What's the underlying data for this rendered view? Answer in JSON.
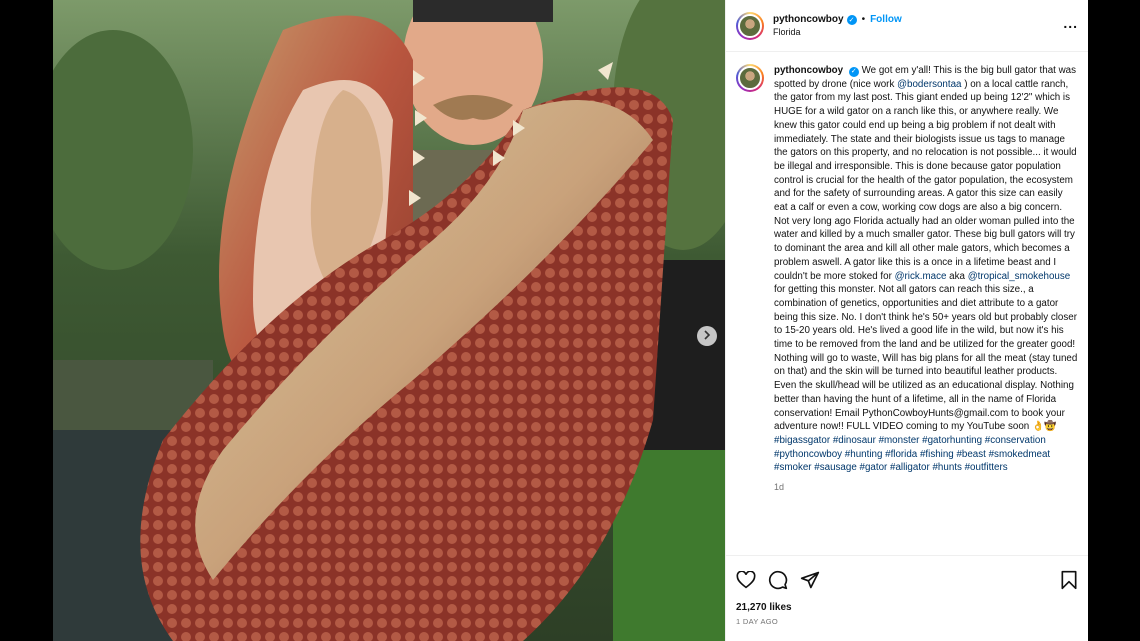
{
  "header": {
    "username": "pythoncowboy",
    "follow_label": "Follow",
    "location": "Florida",
    "more_label": "..."
  },
  "caption": {
    "username": "pythoncowboy",
    "segments": [
      {
        "t": "We got em y'all! This is the big bull gator that was spotted by drone (nice work "
      },
      {
        "t": "@bodersontaa",
        "link": true
      },
      {
        "t": " ) on a local cattle ranch, the gator from my last post. This giant ended up being 12'2\" which is HUGE for a wild gator on a ranch like this, or anywhere really. We knew this gator could end up being a big problem if not dealt with immediately. The state and their biologists issue us tags to manage the gators on this property, and no relocation is not possible... it would be illegal and irresponsible. This is done because gator population control is crucial for the health of the gator population, the ecosystem and for the safety of surrounding areas. A gator this size can easily eat a calf or even a cow, working cow dogs are also a big concern. Not very long ago Florida actually had an older woman pulled into the water and killed by a much smaller gator. These big bull gators will try to dominant the area and kill all other male gators, which becomes a problem aswell. A gator like this is a once in a lifetime beast and I couldn't be more stoked for "
      },
      {
        "t": "@rick.mace",
        "link": true
      },
      {
        "t": " aka "
      },
      {
        "t": "@tropical_smokehouse",
        "link": true
      },
      {
        "t": " for getting this monster. Not all gators can reach this size., a combination of genetics, opportunities and diet attribute to a gator being this size. No. I don't think he's 50+ years old but probably closer to 15-20 years old. He's lived a good life in the wild, but now it's his time to be removed from the land and be utilized for the greater good! Nothing will go to waste, Will has big plans for all the meat (stay tuned on that) and the skin will be turned into beautiful leather products. Even the skull/head will be utilized as an educational display. Nothing better than having the hunt of a lifetime, all in the name of Florida conservation! Email PythonCowboyHunts@gmail.com to book your adventure now!! FULL VIDEO coming to my YouTube soon 👌🤠 "
      },
      {
        "t": "#bigassgator #dinosaur #monster #gatorhunting #conservation #pythoncowboy #hunting #florida #fishing #beast #smokedmeat #smoker #sausage #gator #alligator #hunts #outfitters",
        "link": true
      }
    ],
    "age": "1d"
  },
  "stats": {
    "likes": "21,270 likes",
    "posted": "1 DAY AGO"
  },
  "icons": [
    "heart-icon",
    "comment-icon",
    "share-icon",
    "bookmark-icon",
    "chevron-right-icon",
    "verified-icon"
  ],
  "colors": {
    "accent": "#0095f6",
    "link": "#00376b",
    "muted": "#737373"
  }
}
